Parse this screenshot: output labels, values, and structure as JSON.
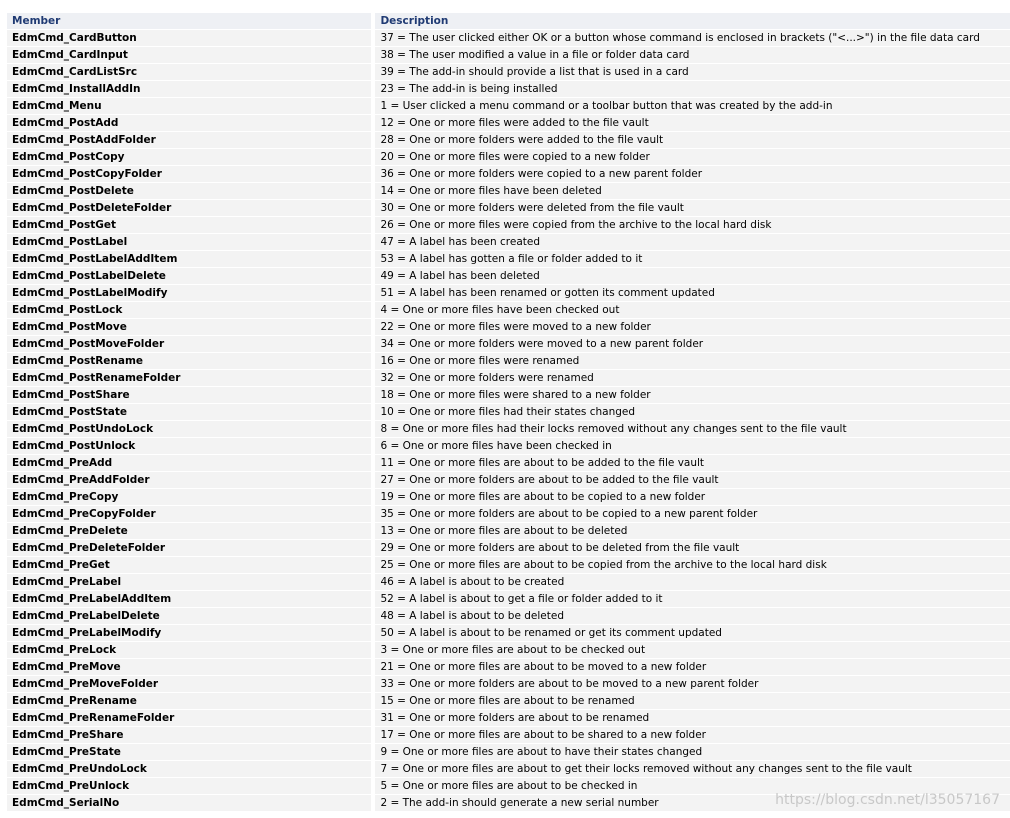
{
  "table": {
    "headers": {
      "member": "Member",
      "description": "Description"
    },
    "rows": [
      {
        "member": "EdmCmd_CardButton",
        "description": "37 = The user clicked either OK or a button whose command is enclosed in brackets (\"<...>\") in the file data card"
      },
      {
        "member": "EdmCmd_CardInput",
        "description": "38 = The user modified a value in a file or folder data card"
      },
      {
        "member": "EdmCmd_CardListSrc",
        "description": "39 = The add-in should provide a list that is used in a card"
      },
      {
        "member": "EdmCmd_InstallAddIn",
        "description": "23 = The add-in is being installed"
      },
      {
        "member": "EdmCmd_Menu",
        "description": "1 = User clicked a menu command or a toolbar button that was created by the add-in"
      },
      {
        "member": "EdmCmd_PostAdd",
        "description": "12 = One or more files were added to the file vault"
      },
      {
        "member": "EdmCmd_PostAddFolder",
        "description": "28 = One or more folders were added to the file vault"
      },
      {
        "member": "EdmCmd_PostCopy",
        "description": "20 = One or more files were copied to a new folder"
      },
      {
        "member": "EdmCmd_PostCopyFolder",
        "description": "36 = One or more folders were copied to a new parent folder"
      },
      {
        "member": "EdmCmd_PostDelete",
        "description": "14 = One or more files have been deleted"
      },
      {
        "member": "EdmCmd_PostDeleteFolder",
        "description": "30 = One or more folders were deleted from the file vault"
      },
      {
        "member": "EdmCmd_PostGet",
        "description": "26 = One or more files were copied from the archive to the local hard disk"
      },
      {
        "member": "EdmCmd_PostLabel",
        "description": "47 = A label has been created"
      },
      {
        "member": "EdmCmd_PostLabelAddItem",
        "description": "53 = A label has gotten a file or folder added to it"
      },
      {
        "member": "EdmCmd_PostLabelDelete",
        "description": "49 = A label has been deleted"
      },
      {
        "member": "EdmCmd_PostLabelModify",
        "description": "51 = A label has been renamed or gotten its comment updated"
      },
      {
        "member": "EdmCmd_PostLock",
        "description": "4 = One or more files have been checked out"
      },
      {
        "member": "EdmCmd_PostMove",
        "description": "22 = One or more files were moved to a new folder"
      },
      {
        "member": "EdmCmd_PostMoveFolder",
        "description": "34 = One or more folders were moved to a new parent folder"
      },
      {
        "member": "EdmCmd_PostRename",
        "description": "16 = One or more files were renamed"
      },
      {
        "member": "EdmCmd_PostRenameFolder",
        "description": "32 = One or more folders were renamed"
      },
      {
        "member": "EdmCmd_PostShare",
        "description": "18 = One or more files were shared to a new folder"
      },
      {
        "member": "EdmCmd_PostState",
        "description": "10 = One or more files had their states changed"
      },
      {
        "member": "EdmCmd_PostUndoLock",
        "description": "8 = One or more files had their locks removed without any changes sent to the file vault"
      },
      {
        "member": "EdmCmd_PostUnlock",
        "description": "6 = One or more files have been checked in"
      },
      {
        "member": "EdmCmd_PreAdd",
        "description": "11 = One or more files are about to be added to the file vault"
      },
      {
        "member": "EdmCmd_PreAddFolder",
        "description": "27 = One or more folders are about to be added to the file vault"
      },
      {
        "member": "EdmCmd_PreCopy",
        "description": "19 = One or more files are about to be copied to a new folder"
      },
      {
        "member": "EdmCmd_PreCopyFolder",
        "description": "35 = One or more folders are about to be copied to a new parent folder"
      },
      {
        "member": "EdmCmd_PreDelete",
        "description": "13 = One or more files are about to be deleted"
      },
      {
        "member": "EdmCmd_PreDeleteFolder",
        "description": "29 = One or more folders are about to be deleted from the file vault"
      },
      {
        "member": "EdmCmd_PreGet",
        "description": "25 = One or more files are about to be copied from the archive to the local hard disk"
      },
      {
        "member": "EdmCmd_PreLabel",
        "description": "46 = A label is about to be created"
      },
      {
        "member": "EdmCmd_PreLabelAddItem",
        "description": "52 = A label is about to get a file or folder added to it"
      },
      {
        "member": "EdmCmd_PreLabelDelete",
        "description": "48 = A label is about to be deleted"
      },
      {
        "member": "EdmCmd_PreLabelModify",
        "description": "50 = A label is about to be renamed or get its comment updated"
      },
      {
        "member": "EdmCmd_PreLock",
        "description": "3 = One or more files are about to be checked out"
      },
      {
        "member": "EdmCmd_PreMove",
        "description": "21 = One or more files are about to be moved to a new folder"
      },
      {
        "member": "EdmCmd_PreMoveFolder",
        "description": "33 = One or more folders are about to be moved to a new parent folder"
      },
      {
        "member": "EdmCmd_PreRename",
        "description": "15 = One or more files are about to be renamed"
      },
      {
        "member": "EdmCmd_PreRenameFolder",
        "description": "31 = One or more folders are about to be renamed"
      },
      {
        "member": "EdmCmd_PreShare",
        "description": "17 = One or more files are about to be shared to a new folder"
      },
      {
        "member": "EdmCmd_PreState",
        "description": "9 = One or more files are about to have their states changed"
      },
      {
        "member": "EdmCmd_PreUndoLock",
        "description": "7 = One or more files are about to get their locks removed without any changes sent to the file vault"
      },
      {
        "member": "EdmCmd_PreUnlock",
        "description": "5 = One or more files are about to be checked in"
      },
      {
        "member": "EdmCmd_SerialNo",
        "description": "2 = The add-in should generate a new serial number"
      }
    ]
  },
  "watermark": "https://blog.csdn.net/l35057167"
}
